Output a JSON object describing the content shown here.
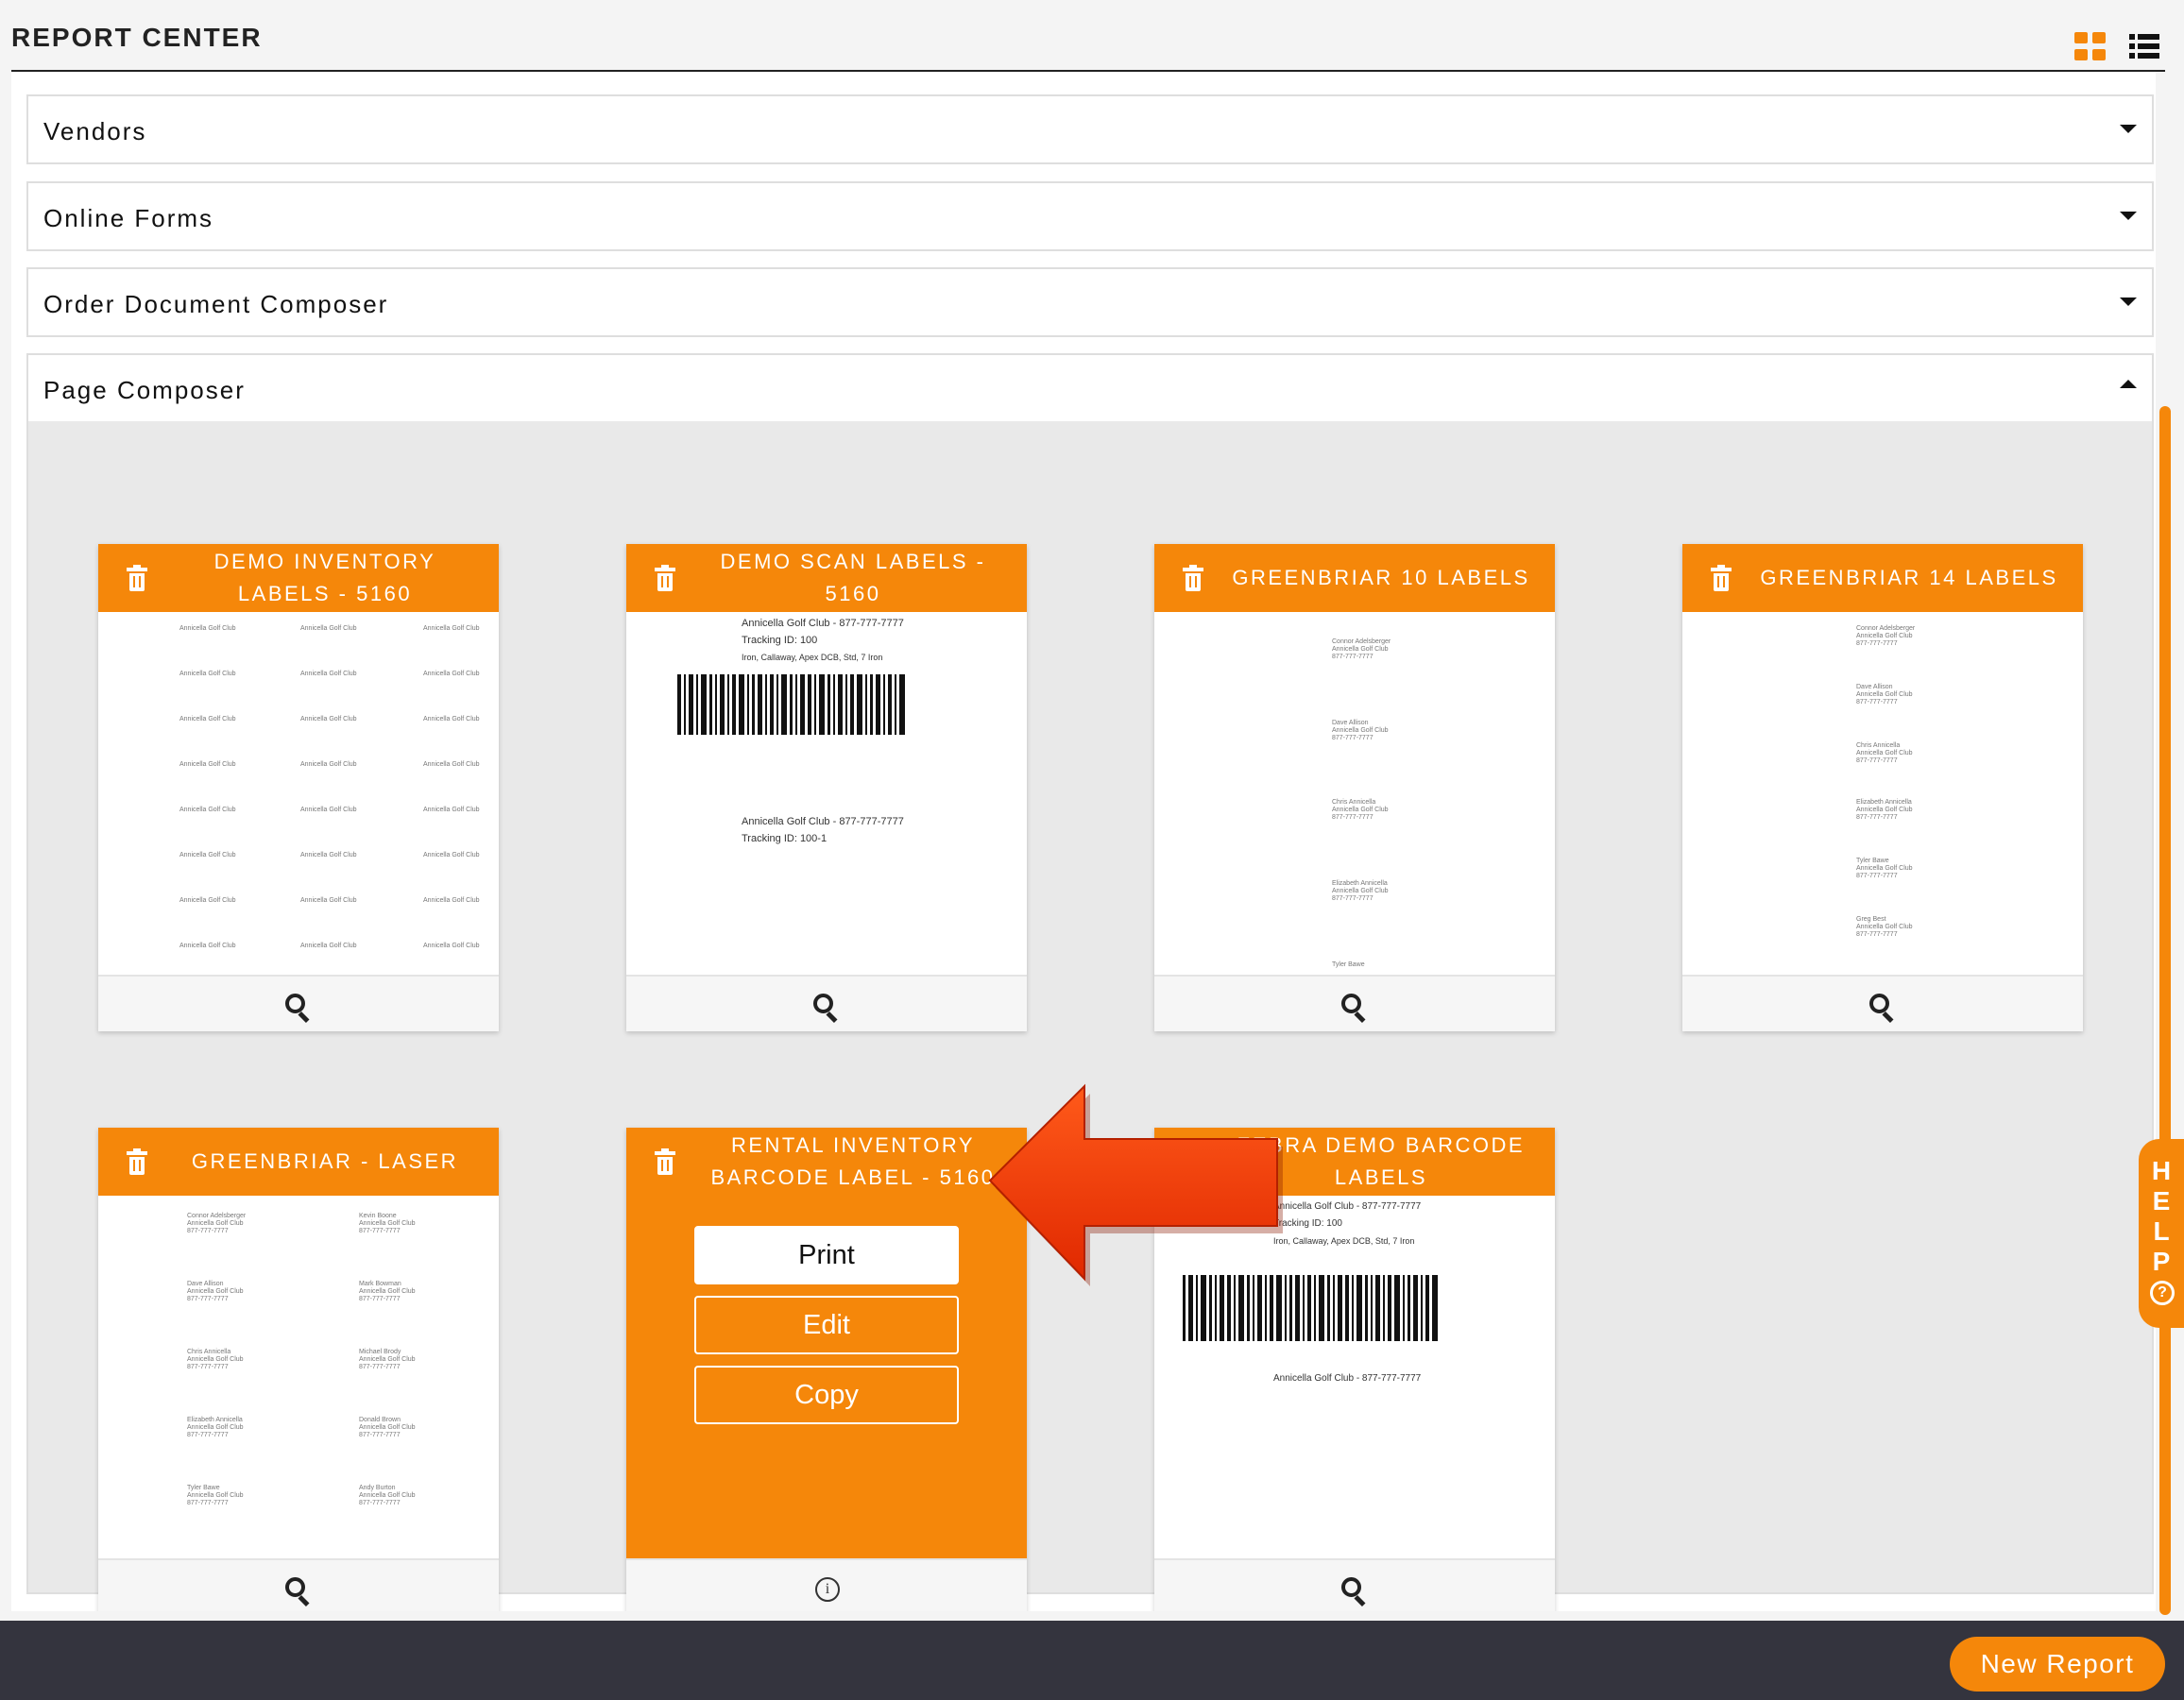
{
  "header": {
    "title": "REPORT CENTER"
  },
  "view_toggle": {
    "grid_icon": "grid-view-icon",
    "list_icon": "list-view-icon",
    "active": "grid"
  },
  "accordion": [
    {
      "label": "Vendors",
      "expanded": false
    },
    {
      "label": "Online Forms",
      "expanded": false
    },
    {
      "label": "Order Document Composer",
      "expanded": false
    },
    {
      "label": "Page Composer",
      "expanded": true
    }
  ],
  "cards": [
    {
      "title": "DEMO INVENTORY LABELS - 5160",
      "footer_icon": "search-icon"
    },
    {
      "title": "DEMO SCAN LABELS - 5160",
      "footer_icon": "search-icon",
      "preview": {
        "line1": "Annicella Golf Club - 877-777-7777",
        "line2": "Tracking ID: 100",
        "line3": "Iron, Callaway, Apex DCB, Std, 7 Iron",
        "line4": "Annicella Golf Club - 877-777-7777",
        "line5": "Tracking ID: 100-1"
      }
    },
    {
      "title": "GREENBRIAR 10 LABELS",
      "footer_icon": "search-icon"
    },
    {
      "title": "GREENBRIAR 14 LABELS",
      "footer_icon": "search-icon"
    },
    {
      "title": "GREENBRIAR - LASER",
      "footer_icon": "search-icon"
    },
    {
      "title": "RENTAL INVENTORY BARCODE LABEL - 5160",
      "footer_icon": "info-icon",
      "actions": {
        "print": "Print",
        "edit": "Edit",
        "copy": "Copy"
      }
    },
    {
      "title": "ZEBRA DEMO BARCODE LABELS",
      "footer_icon": "search-icon",
      "preview": {
        "line1": "Annicella Golf Club - 877-777-7777",
        "line2": "Tracking ID: 100",
        "line3": "Iron, Callaway, Apex DCB, Std, 7 Iron",
        "line4": "Annicella Golf Club - 877-777-7777"
      }
    }
  ],
  "label_snippets": {
    "club": "Annicella Golf Club",
    "phone": "877-777-7777",
    "names_a": [
      "Connor Adelsberger",
      "Dave Allison",
      "Chris Annicella",
      "Elizabeth Annicella",
      "Tyler Bawe",
      "Greg Best"
    ],
    "names_b": [
      "Kevin Boone",
      "Mark Bowman",
      "Michael Brody",
      "Donald Brown",
      "Andy Burton"
    ]
  },
  "help": {
    "letters": "H E L P",
    "icon": "question-circle-icon"
  },
  "footer": {
    "new_report": "New Report"
  },
  "colors": {
    "accent": "#f5870a",
    "footer_bg": "#34343e",
    "panel_bg": "#e9e9e9"
  }
}
